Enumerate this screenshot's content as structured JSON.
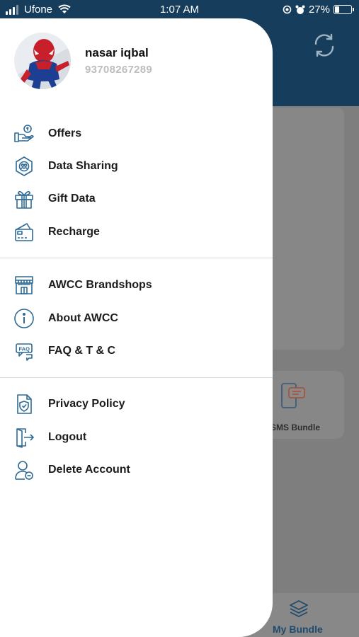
{
  "status_bar": {
    "carrier": "Ufone",
    "time": "1:07 AM",
    "battery_percent": "27%",
    "battery_level": 0.27
  },
  "profile": {
    "name": "nasar iqbal",
    "phone": "93708267289"
  },
  "menu_groups": [
    [
      {
        "label": "Offers",
        "icon": "hand-coin-icon"
      },
      {
        "label": "Data Sharing",
        "icon": "data-sharing-icon"
      },
      {
        "label": "Gift Data",
        "icon": "gift-icon"
      },
      {
        "label": "Recharge",
        "icon": "recharge-card-icon"
      }
    ],
    [
      {
        "label": "AWCC Brandshops",
        "icon": "store-icon"
      },
      {
        "label": "About AWCC",
        "icon": "info-icon"
      },
      {
        "label": "FAQ & T & C",
        "icon": "faq-icon"
      }
    ],
    [
      {
        "label": "Privacy Policy",
        "icon": "shield-document-icon"
      },
      {
        "label": "Logout",
        "icon": "logout-icon"
      },
      {
        "label": "Delete Account",
        "icon": "delete-user-icon"
      }
    ]
  ],
  "background": {
    "sms_bundle_label": "SMS Bundle",
    "my_bundle_label": "My Bundle"
  },
  "colors": {
    "accent": "#163e5c",
    "icon": "#2d6a96"
  }
}
